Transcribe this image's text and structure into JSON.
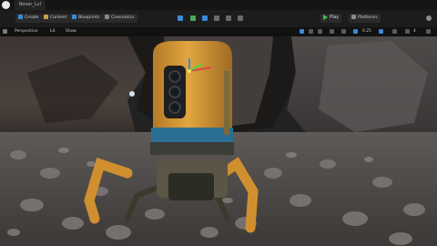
{
  "window": {
    "tab_label": "Rover_Lvl"
  },
  "toolbar": {
    "create_label": "Create",
    "content_label": "Content",
    "blueprints_label": "Blueprints",
    "cinematics_label": "Cinematics",
    "play_label": "Play",
    "platforms_label": "Platforms"
  },
  "viewport": {
    "view_mode_label": "Perspective",
    "lit_label": "Lit",
    "show_label": "Show",
    "snap_value": "0.25",
    "camera_speed": "4"
  },
  "colors": {
    "accent": "#e0a236",
    "play_green": "#3fc24b",
    "tool_blue": "#3a8ad6"
  }
}
